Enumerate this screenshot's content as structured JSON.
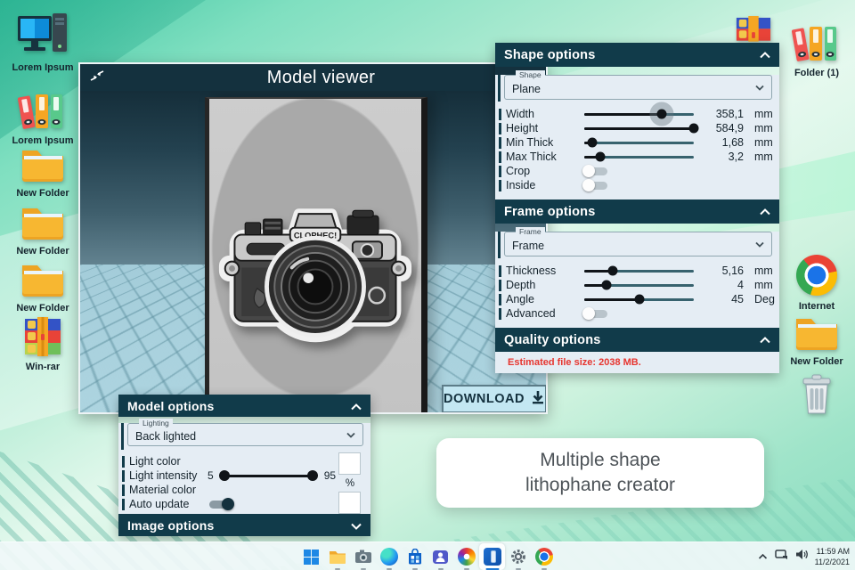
{
  "desktop": {
    "icons_left": [
      {
        "name": "computer",
        "label": "Lorem Ipsum"
      },
      {
        "name": "binders",
        "label": "Lorem Ipsum"
      },
      {
        "name": "folder",
        "label": "New Folder"
      },
      {
        "name": "folder",
        "label": "New Folder"
      },
      {
        "name": "folder",
        "label": "New Folder"
      },
      {
        "name": "winrar",
        "label": "Win-rar"
      }
    ],
    "icons_right": [
      {
        "name": "binders",
        "label": "Folder (1)"
      },
      {
        "name": "chrome",
        "label": "Internet"
      },
      {
        "name": "folder",
        "label": "New Folder"
      },
      {
        "name": "trash",
        "label": ""
      }
    ],
    "caption": {
      "line1": "Multiple shape",
      "line2": "lithophane creator"
    }
  },
  "viewer": {
    "title": "Model viewer",
    "download": "DOWNLOAD",
    "camera_label": "CLOPHEC!"
  },
  "shape_panel": {
    "title": "Shape options",
    "dropdown": {
      "label": "Shape",
      "value": "Plane"
    },
    "sliders": [
      {
        "label": "Width",
        "value": "358,1",
        "unit": "mm",
        "pct": 71
      },
      {
        "label": "Height",
        "value": "584,9",
        "unit": "mm",
        "pct": 100
      },
      {
        "label": "Min Thick",
        "value": "1,68",
        "unit": "mm",
        "pct": 7
      },
      {
        "label": "Max Thick",
        "value": "3,2",
        "unit": "mm",
        "pct": 15
      }
    ],
    "toggles": [
      {
        "label": "Crop",
        "on": false
      },
      {
        "label": "Inside",
        "on": false
      }
    ]
  },
  "frame_panel": {
    "title": "Frame options",
    "dropdown": {
      "label": "Frame",
      "value": "Frame"
    },
    "sliders": [
      {
        "label": "Thickness",
        "value": "5,16",
        "unit": "mm",
        "pct": 26
      },
      {
        "label": "Depth",
        "value": "4",
        "unit": "mm",
        "pct": 20
      },
      {
        "label": "Angle",
        "value": "45",
        "unit": "Deg",
        "pct": 50
      }
    ],
    "toggles": [
      {
        "label": "Advanced",
        "on": false
      }
    ]
  },
  "quality_panel": {
    "title": "Quality options",
    "estimate": "Estimated file size: 2038 MB."
  },
  "model_panel": {
    "title": "Model options",
    "dropdown": {
      "label": "Lighting",
      "value": "Back lighted"
    },
    "light_color_label": "Light color",
    "light_intensity_label": "Light intensity",
    "intensity_min": "5",
    "intensity_max": "95",
    "intensity_unit": "%",
    "material_color_label": "Material color",
    "auto_update_label": "Auto update",
    "auto_update_on": true
  },
  "image_panel": {
    "title": "Image options"
  },
  "taskbar": {
    "time": "11:59 AM",
    "date": "11/2/2021",
    "app_icons": [
      "windows",
      "file-explorer",
      "camera",
      "edge",
      "store",
      "teams",
      "photos",
      "lithophane-app",
      "settings",
      "chrome"
    ]
  }
}
